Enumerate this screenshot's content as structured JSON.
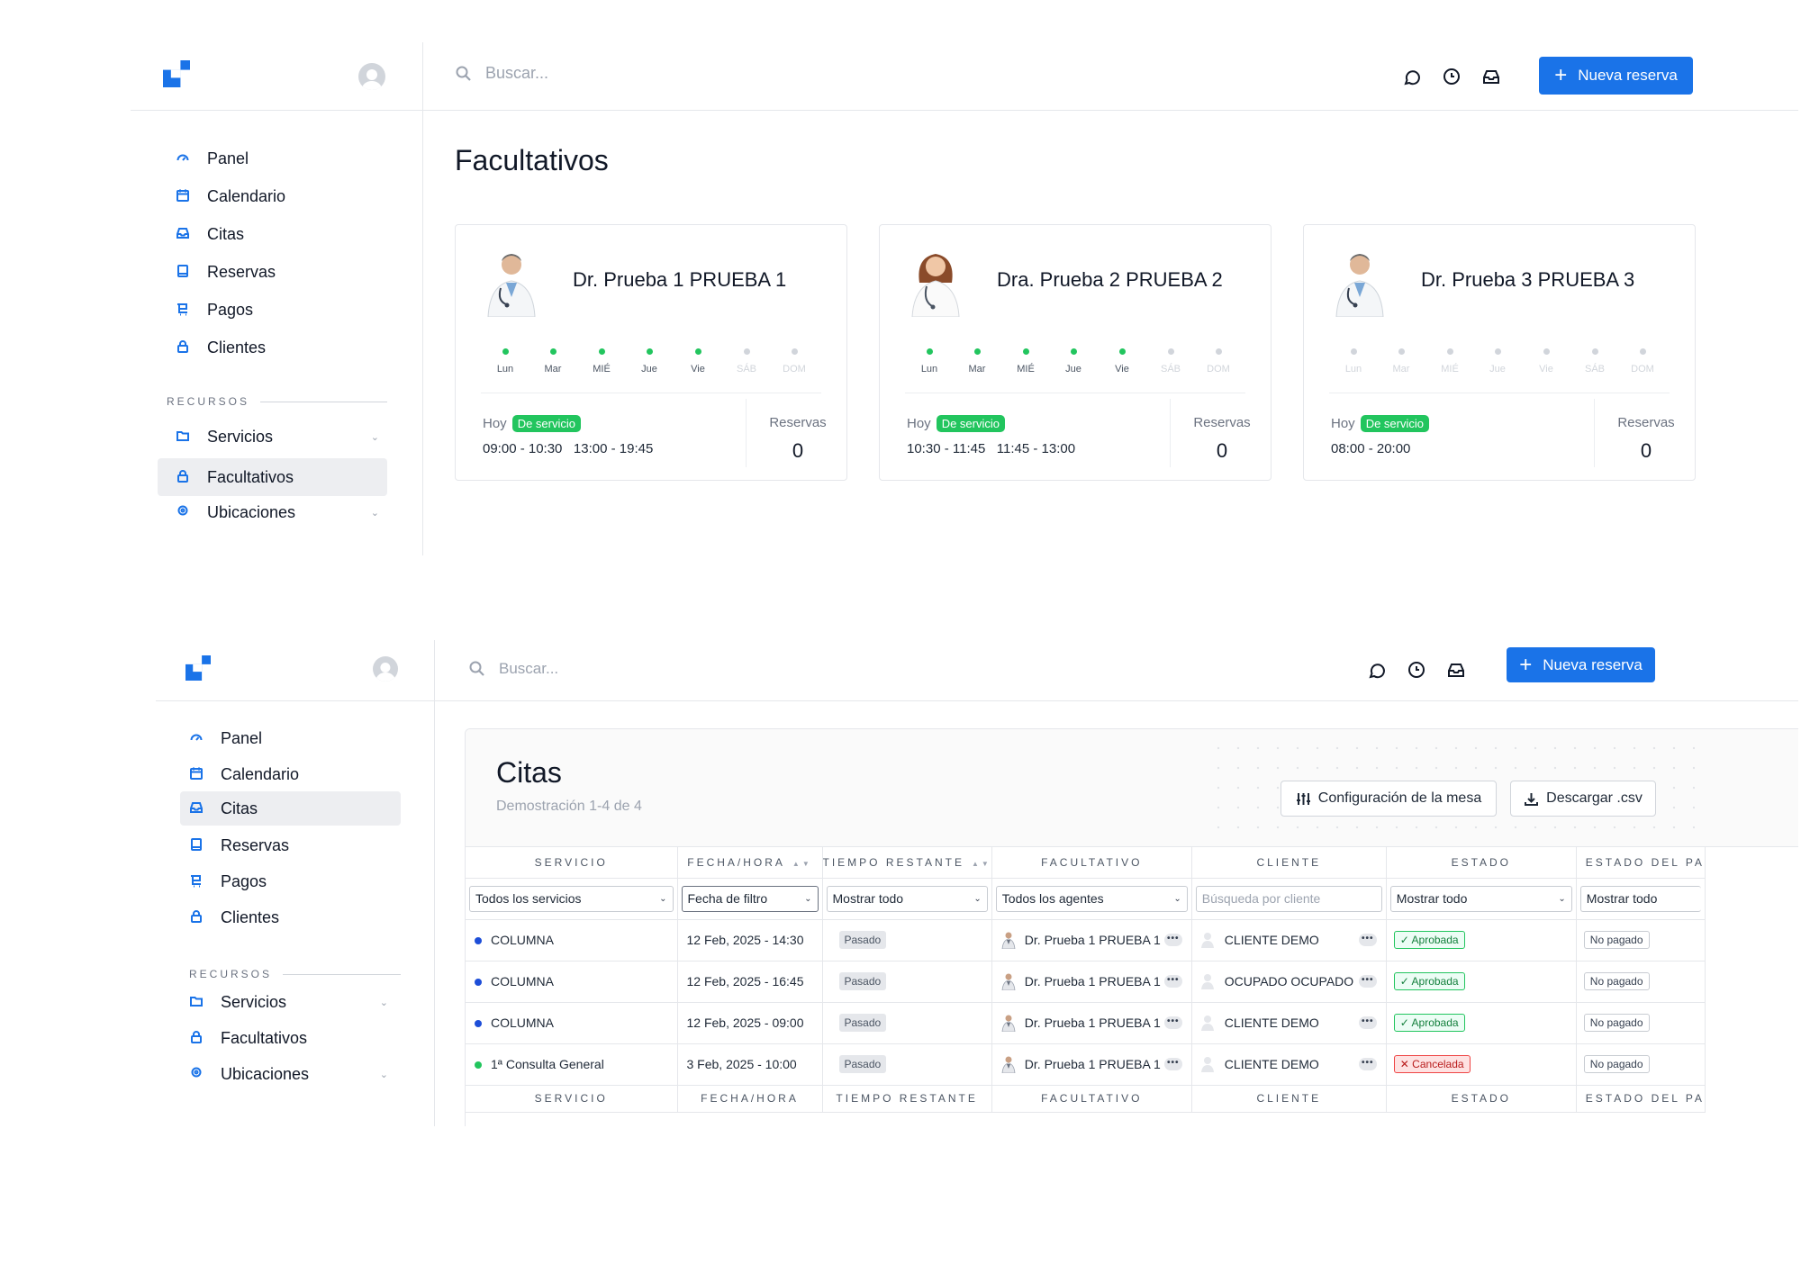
{
  "brand": {
    "logo_icon": "app-logo-icon",
    "accent": "#1a73e8"
  },
  "common": {
    "search_placeholder": "Buscar...",
    "new_booking": "Nueva reserva",
    "top_icons": [
      "chat-bubble-icon",
      "clock-icon",
      "inbox-icon"
    ],
    "nav": {
      "items": [
        {
          "label": "Panel",
          "icon": "dashboard-icon"
        },
        {
          "label": "Calendario",
          "icon": "calendar-icon"
        },
        {
          "label": "Citas",
          "icon": "inbox-icon"
        },
        {
          "label": "Reservas",
          "icon": "book-icon"
        },
        {
          "label": "Pagos",
          "icon": "cart-icon"
        },
        {
          "label": "Clientes",
          "icon": "user-icon"
        }
      ],
      "section": "RECURSOS",
      "resources": [
        {
          "label": "Servicios",
          "icon": "folder-icon"
        },
        {
          "label": "Facultativos",
          "icon": "user-icon"
        },
        {
          "label": "Ubicaciones",
          "icon": "location-icon"
        }
      ]
    }
  },
  "facultativos": {
    "title": "Facultativos",
    "day_labels": [
      "Lun",
      "Mar",
      "MIÉ",
      "Jue",
      "Vie",
      "SÁB",
      "DOM"
    ],
    "today_label": "Hoy",
    "on_duty": "De servicio",
    "reservas_label": "Reservas",
    "doctors": [
      {
        "name": "Dr. Prueba 1 PRUEBA 1",
        "hours": "09:00 - 10:30   13:00 - 19:45",
        "reservas": "0"
      },
      {
        "name": "Dra. Prueba 2 PRUEBA 2",
        "hours": "10:30 - 11:45   11:45 - 13:00",
        "reservas": "0"
      },
      {
        "name": "Dr. Prueba 3 PRUEBA 3",
        "hours": "08:00 - 20:00",
        "reservas": "0"
      }
    ]
  },
  "citas": {
    "title": "Citas",
    "subtitle": "Demostración 1-4 de 4",
    "table_config": "Configuración de la mesa",
    "download_csv": "Descargar .csv",
    "columns": [
      "SERVICIO",
      "FECHA/HORA",
      "TIEMPO RESTANTE",
      "FACULTATIVO",
      "CLIENTE",
      "ESTADO",
      "ESTADO DEL PA"
    ],
    "filters": {
      "servicio": "Todos los servicios",
      "fecha": "Fecha de filtro",
      "tiempo": "Mostrar todo",
      "facultativo": "Todos los agentes",
      "cliente": "Búsqueda por cliente",
      "estado": "Mostrar todo",
      "pago": "Mostrar todo"
    },
    "rows": [
      {
        "servicio": "COLUMNA",
        "color": "#1d4ed8",
        "fecha": "12 Feb, 2025 - 14:30",
        "tiempo": "Pasado",
        "facultativo": "Dr. Prueba 1 PRUEBA 1",
        "cliente": "CLIENTE DEMO",
        "estado": "✓ Aprobada",
        "pago": "No pagado"
      },
      {
        "servicio": "COLUMNA",
        "color": "#1d4ed8",
        "fecha": "12 Feb, 2025 - 16:45",
        "tiempo": "Pasado",
        "facultativo": "Dr. Prueba 1 PRUEBA 1",
        "cliente": "OCUPADO OCUPADO",
        "estado": "✓ Aprobada",
        "pago": "No pagado"
      },
      {
        "servicio": "COLUMNA",
        "color": "#1d4ed8",
        "fecha": "12 Feb, 2025 - 09:00",
        "tiempo": "Pasado",
        "facultativo": "Dr. Prueba 1 PRUEBA 1",
        "cliente": "CLIENTE DEMO",
        "estado": "✓ Aprobada",
        "pago": "No pagado"
      },
      {
        "servicio": "1ª Consulta General",
        "color": "#22c55e",
        "fecha": "3 Feb, 2025 - 10:00",
        "tiempo": "Pasado",
        "facultativo": "Dr. Prueba 1 PRUEBA 1",
        "cliente": "CLIENTE DEMO",
        "estado": "✕ Cancelada",
        "pago": "No pagado"
      }
    ]
  }
}
